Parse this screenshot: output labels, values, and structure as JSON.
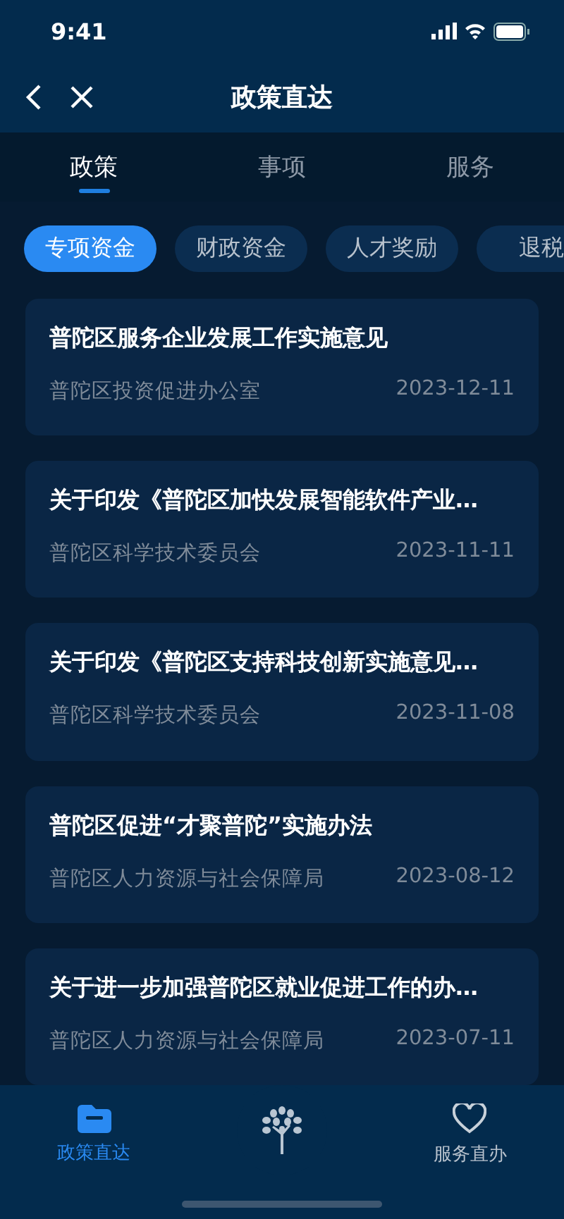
{
  "status_bar": {
    "time": "9:41"
  },
  "nav": {
    "title": "政策直达"
  },
  "tabs": [
    {
      "label": "政策",
      "selected": true
    },
    {
      "label": "事项",
      "selected": false
    },
    {
      "label": "服务",
      "selected": false
    }
  ],
  "chips": [
    {
      "label": "专项资金",
      "selected": true
    },
    {
      "label": "财政资金",
      "selected": false
    },
    {
      "label": "人才奖励",
      "selected": false
    },
    {
      "label": "退税",
      "selected": false
    }
  ],
  "policies": [
    {
      "title": "普陀区服务企业发展工作实施意见",
      "department": "普陀区投资促进办公室",
      "date": "2023-12-11"
    },
    {
      "title": "关于印发《普陀区加快发展智能软件产业…",
      "department": "普陀区科学技术委员会",
      "date": "2023-11-11"
    },
    {
      "title": "关于印发《普陀区支持科技创新实施意见…",
      "department": "普陀区科学技术委员会",
      "date": "2023-11-08"
    },
    {
      "title": "普陀区促进“才聚普陀”实施办法",
      "department": "普陀区人力资源与社会保障局",
      "date": "2023-08-12"
    },
    {
      "title": "关于进一步加强普陀区就业促进工作的办…",
      "department": "普陀区人力资源与社会保障局",
      "date": "2023-07-11"
    }
  ],
  "bottom_nav": [
    {
      "label": "政策直达",
      "kind": "folder",
      "selected": true
    },
    {
      "kind": "tree"
    },
    {
      "label": "服务直办",
      "kind": "heart",
      "selected": false
    }
  ]
}
